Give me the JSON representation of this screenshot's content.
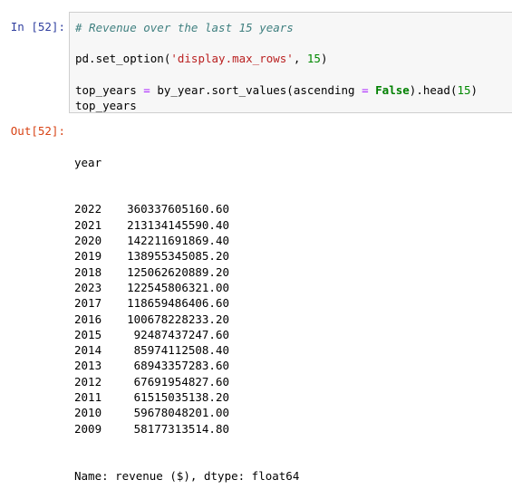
{
  "cell": {
    "in_prompt": "In [52]:",
    "out_prompt": "Out[52]:",
    "code": {
      "comment": "# Revenue over the last 15 years",
      "line2": {
        "prefix": "pd.set_option(",
        "string": "'display.max_rows'",
        "sep": ", ",
        "number": "15",
        "suffix": ")"
      },
      "line3": {
        "prefix": "top_years ",
        "op1": "=",
        "mid": " by_year.sort_values(ascending ",
        "op2": "=",
        "space": " ",
        "kw": "False",
        "mid2": ").head(",
        "number": "15",
        "suffix": ")"
      },
      "line4": "top_years"
    },
    "output": {
      "index_name": "year",
      "rows": [
        {
          "year": "2022",
          "value": "360337605160.60"
        },
        {
          "year": "2021",
          "value": "213134145590.40"
        },
        {
          "year": "2020",
          "value": "142211691869.40"
        },
        {
          "year": "2019",
          "value": "138955345085.20"
        },
        {
          "year": "2018",
          "value": "125062620889.20"
        },
        {
          "year": "2023",
          "value": "122545806321.00"
        },
        {
          "year": "2017",
          "value": "118659486406.60"
        },
        {
          "year": "2016",
          "value": "100678228233.20"
        },
        {
          "year": "2015",
          "value": "92487437247.60"
        },
        {
          "year": "2014",
          "value": "85974112508.40"
        },
        {
          "year": "2013",
          "value": "68943357283.60"
        },
        {
          "year": "2012",
          "value": "67691954827.60"
        },
        {
          "year": "2011",
          "value": "61515035138.20"
        },
        {
          "year": "2010",
          "value": "59678048201.00"
        },
        {
          "year": "2009",
          "value": "58177313514.80"
        }
      ],
      "footer": "Name: revenue ($), dtype: float64"
    }
  }
}
